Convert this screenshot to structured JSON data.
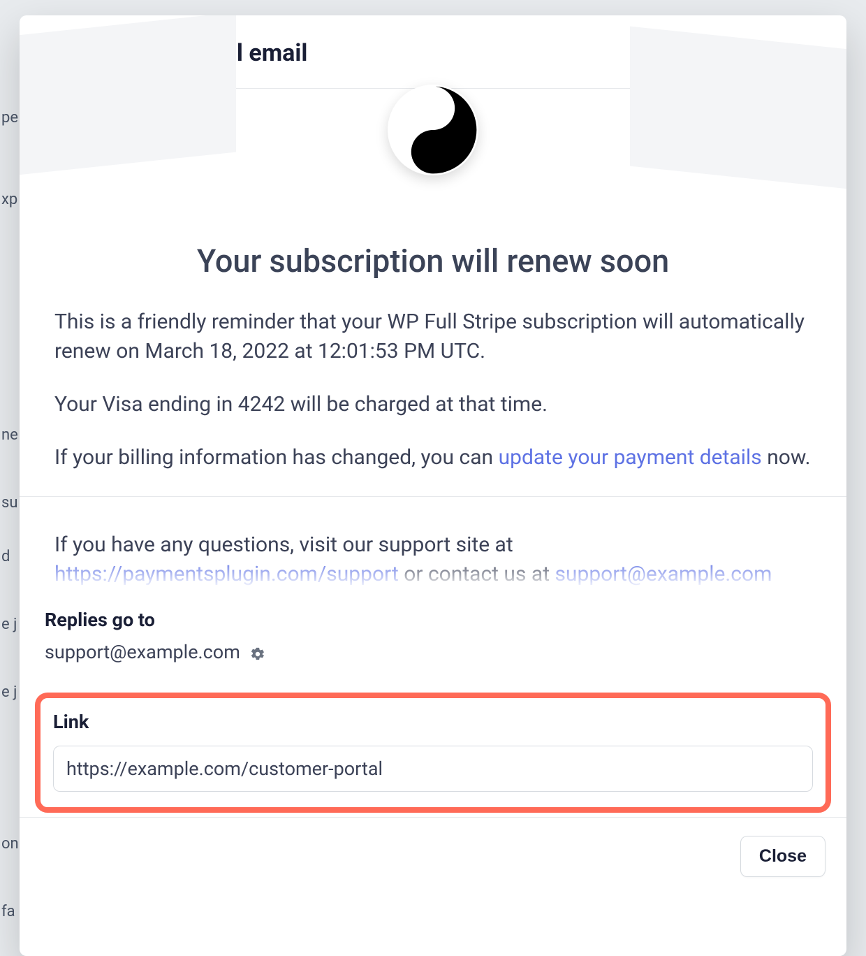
{
  "modal": {
    "title": "Upcoming renewal email"
  },
  "email": {
    "headline": "Your subscription will renew soon",
    "para1": "This is a friendly reminder that your WP Full Stripe subscription will automatically renew on March 18, 2022 at 12:01:53 PM UTC.",
    "para2": "Your Visa ending in 4242 will be charged at that time.",
    "para3_a": "If your billing information has changed, you can ",
    "para3_link": "update your payment details",
    "para3_b": " now.",
    "support_a": "If you have any questions, visit our support site at ",
    "support_link": "https://paymentsplugin.com/support",
    "support_b": " or contact us at ",
    "support_email": "support@example.com"
  },
  "replies": {
    "label": "Replies go to",
    "email": "support@example.com"
  },
  "link": {
    "label": "Link",
    "value": "https://example.com/customer-portal"
  },
  "footer": {
    "close": "Close"
  },
  "icons": {
    "logo": "yinyang-icon",
    "gear": "gear-icon"
  }
}
